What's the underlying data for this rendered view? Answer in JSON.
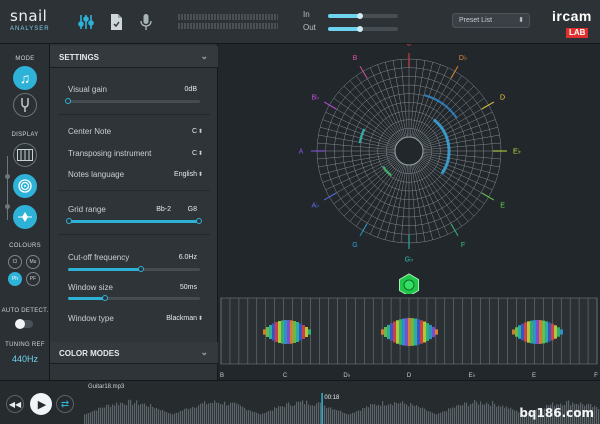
{
  "app": {
    "name_line1": "snail",
    "name_line2": "ANALYSER"
  },
  "top": {
    "in_label": "In",
    "out_label": "Out",
    "in_level": 0.45,
    "out_level": 0.45,
    "preset_placeholder": "Preset List",
    "brand_line1": "ircam",
    "brand_line2": "LAB"
  },
  "left": {
    "mode_label": "MODE",
    "display_label": "DISPLAY",
    "colours_label": "COLOURS",
    "colour_options": [
      "Cl",
      "Mu",
      "Ph",
      "PF"
    ],
    "auto_detect_label": "AUTO DETECT.",
    "tuning_ref_label": "TUNING REF",
    "tuning_ref_value": "440Hz"
  },
  "settings": {
    "title": "SETTINGS",
    "visual_gain_label": "Visual gain",
    "visual_gain_value": "0dB",
    "visual_gain_level": 0.0,
    "center_note_label": "Center Note",
    "center_note_value": "C",
    "transposing_label": "Transposing instrument",
    "transposing_value": "C",
    "notes_language_label": "Notes language",
    "notes_language_value": "English",
    "grid_range_label": "Grid range",
    "grid_range_low": "Bb-2",
    "grid_range_high": "G8",
    "cutoff_label": "Cut-off frequency",
    "cutoff_value": "6.0Hz",
    "cutoff_level": 0.55,
    "window_size_label": "Window size",
    "window_size_value": "50ms",
    "window_size_level": 0.28,
    "window_type_label": "Window type",
    "window_type_value": "Blackman",
    "color_modes_title": "COLOR MODES"
  },
  "spiral": {
    "notes": [
      "C",
      "D♭",
      "D",
      "E♭",
      "E",
      "F",
      "G♭",
      "G",
      "A♭",
      "A",
      "B♭",
      "B"
    ],
    "note_colors": [
      "#e8424a",
      "#f18a2f",
      "#f6d33a",
      "#c9e23d",
      "#6fd54a",
      "#33c47a",
      "#2fc2b4",
      "#2f9fe0",
      "#5b6ff0",
      "#8a55e8",
      "#c44fe0",
      "#e04fa0"
    ]
  },
  "strip": {
    "axis_labels": [
      "B",
      "C",
      "D♭",
      "D",
      "E♭",
      "E",
      "F"
    ]
  },
  "transport": {
    "filename": "Guitar18.mp3",
    "time": "00:18",
    "progress": 0.46
  },
  "watermark": "bq186.com"
}
